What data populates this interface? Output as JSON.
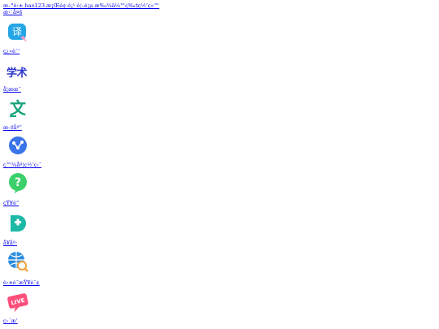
{
  "header": {
    "line1": "æ–°è‹± hao123 æ¡Œé¢ é¡¹ é¦–é¡µ æ‰¾ä¼™ç‰‡ç½‘ç«™",
    "line2": "æ›´å¤š"
  },
  "tiles": [
    {
      "icon": "translate-icon",
      "icon_text": "译",
      "label": "ç¿»è¯‘"
    },
    {
      "icon": "academic-icon",
      "icon_text": "学术",
      "label": "å­¦æœ¯"
    },
    {
      "icon": "wenku-icon",
      "icon_text": "文",
      "label": "æ–‡åº“"
    },
    {
      "icon": "share-icon",
      "icon_text": "",
      "label": "ç™¾åº¦ç½‘ç›˜"
    },
    {
      "icon": "question-icon",
      "icon_text": "?",
      "label": "çŸ¥é“"
    },
    {
      "icon": "health-icon",
      "icon_text": "",
      "label": "å¥åº·"
    },
    {
      "icon": "globe-search-icon",
      "icon_text": "",
      "label": "è‹±è¯­æŸ¥è¯¢"
    },
    {
      "icon": "live-icon",
      "icon_text": "LIVE",
      "label": "ç›´æ’­"
    }
  ],
  "colors": {
    "link": "#0000ee",
    "translate": "#24a6e6",
    "academic": "#2a36c8",
    "wenku": "#1aa37a",
    "share": "#3b73e8",
    "question": "#3ccf6b",
    "health": "#1db8a6",
    "globe": "#2a8be0",
    "live": "#ff4f7a"
  }
}
